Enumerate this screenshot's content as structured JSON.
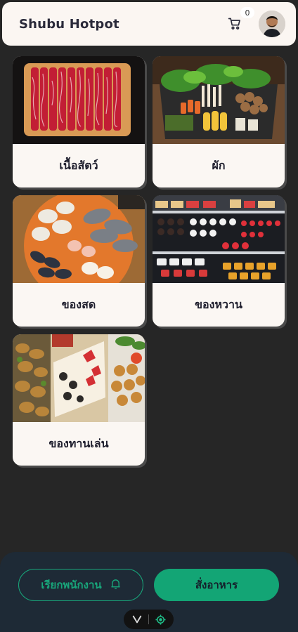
{
  "header": {
    "title": "Shubu Hotpot",
    "cart_icon": "cart-icon",
    "cart_count": "0",
    "avatar_icon": "user-avatar"
  },
  "categories": [
    {
      "label": "เนื้อสัตว์",
      "image": "raw-beef-slices-photo"
    },
    {
      "label": "ผัก",
      "image": "vegetable-platter-photo"
    },
    {
      "label": "ของสด",
      "image": "seafood-platter-photo"
    },
    {
      "label": "ของหวาน",
      "image": "dessert-display-photo"
    },
    {
      "label": "ของทานเล่น",
      "image": "snacks-collage-photo"
    }
  ],
  "bottom": {
    "call_staff_label": "เรียกพนักงาน",
    "call_staff_icon": "bell-icon",
    "order_label": "สั่งอาหาร"
  },
  "dock": {
    "left_icon": "chevron-v-icon",
    "right_icon": "target-icon"
  },
  "colors": {
    "background": "#262626",
    "header_bg": "#fbf6f2",
    "card_bg": "#fbf7f3",
    "accent_green": "#13a575",
    "bottom_bar": "#1e2a36"
  }
}
